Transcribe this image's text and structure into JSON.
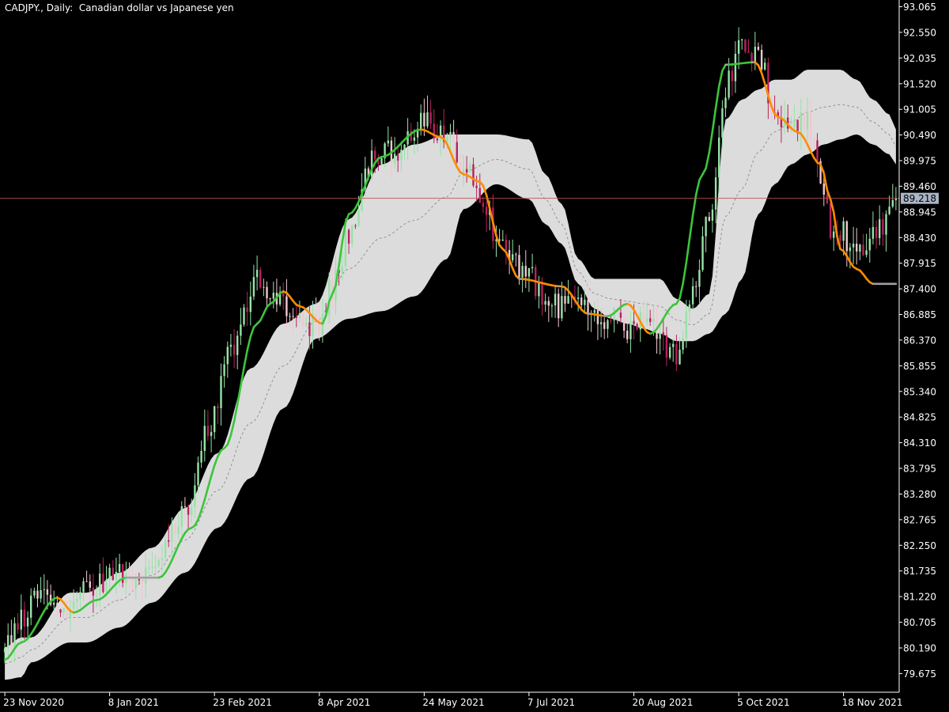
{
  "header": {
    "symbol": "CADJPY.",
    "timeframe": "Daily",
    "description": "Canadian dollar vs Japanese yen"
  },
  "colors": {
    "background": "#000000",
    "axis": "#ffffff",
    "band_fill": "#dcdcdc",
    "mid_line": "#808080",
    "bull_candle": "#98e3a8",
    "bear_candle": "#b8215f",
    "bear_candle_light": "#f2c6d2",
    "line_up": "#3cc43c",
    "line_down": "#ff8c00",
    "line_flat": "#a0a0a0",
    "current_price_line": "#c05050",
    "current_price_box": "#a9b5c4"
  },
  "current_price": {
    "label": "89.218",
    "value": 89.218
  },
  "chart_data": {
    "type": "candlestick",
    "title": "CADJPY., Daily:  Canadian dollar vs Japanese yen",
    "ylim": [
      79.3,
      93.2
    ],
    "y_ticks": [
      "93.065",
      "92.550",
      "92.035",
      "91.520",
      "91.005",
      "90.490",
      "89.975",
      "89.460",
      "88.945",
      "88.430",
      "87.915",
      "87.400",
      "86.885",
      "86.370",
      "85.855",
      "85.340",
      "84.825",
      "84.310",
      "83.795",
      "83.280",
      "82.765",
      "82.250",
      "81.735",
      "81.220",
      "80.705",
      "80.190",
      "79.675"
    ],
    "x_ticks": [
      "23 Nov 2020",
      "8 Jan 2021",
      "23 Feb 2021",
      "8 Apr 2021",
      "24 May 2021",
      "7 Jul 2021",
      "20 Aug 2021",
      "5 Oct 2021",
      "18 Nov 2021"
    ],
    "x_tick_index": [
      0,
      32,
      64,
      96,
      128,
      160,
      192,
      224,
      256
    ],
    "bars": 273,
    "moving_average": {
      "knots_index": [
        0,
        5,
        16,
        21,
        28,
        37,
        47,
        57,
        67,
        77,
        81,
        85,
        90,
        97,
        100,
        105,
        115,
        127,
        133,
        140,
        145,
        152,
        157,
        170,
        178,
        184,
        190,
        197,
        205,
        213,
        220,
        229,
        236,
        242,
        249,
        252,
        255,
        260,
        265,
        272
      ],
      "values": [
        79.95,
        80.3,
        81.2,
        80.9,
        81.15,
        81.6,
        81.6,
        82.6,
        84.2,
        86.7,
        87.1,
        87.35,
        87.05,
        86.7,
        87.3,
        88.9,
        90.05,
        90.6,
        90.45,
        89.7,
        89.55,
        88.2,
        87.6,
        87.45,
        86.9,
        86.85,
        87.1,
        86.5,
        87.1,
        89.7,
        91.9,
        91.95,
        90.85,
        90.55,
        89.9,
        89.2,
        88.2,
        87.8,
        87.5,
        87.5
      ]
    },
    "bands": {
      "knots_index": [
        0,
        5,
        8,
        20,
        25,
        35,
        45,
        55,
        65,
        75,
        85,
        95,
        105,
        115,
        125,
        135,
        140,
        150,
        160,
        165,
        170,
        175,
        180,
        185,
        190,
        195,
        200,
        205,
        210,
        215,
        220,
        225,
        230,
        235,
        240,
        245,
        250,
        255,
        260,
        265,
        270,
        272
      ],
      "upper": [
        80.2,
        80.4,
        80.4,
        81.3,
        81.3,
        81.7,
        82.2,
        83.0,
        84.1,
        85.8,
        86.7,
        87.1,
        88.8,
        89.9,
        90.3,
        90.5,
        90.5,
        90.5,
        90.4,
        89.7,
        89.1,
        88.0,
        87.6,
        87.6,
        87.6,
        87.6,
        87.6,
        87.2,
        87.0,
        87.3,
        90.8,
        91.2,
        91.4,
        91.6,
        91.6,
        91.8,
        91.8,
        91.8,
        91.6,
        91.2,
        90.9,
        90.6
      ],
      "lower": [
        79.55,
        79.6,
        79.9,
        80.3,
        80.3,
        80.6,
        81.1,
        81.7,
        82.6,
        83.6,
        85.0,
        86.4,
        86.8,
        86.95,
        87.25,
        88.0,
        89.0,
        89.5,
        89.2,
        88.7,
        88.3,
        87.5,
        87.0,
        86.8,
        86.7,
        86.6,
        86.5,
        86.35,
        86.35,
        86.5,
        86.9,
        87.6,
        88.9,
        89.5,
        89.9,
        90.1,
        90.3,
        90.4,
        90.5,
        90.3,
        90.1,
        89.9
      ]
    },
    "price_path": {
      "knots_index": [
        0,
        5,
        12,
        18,
        25,
        32,
        40,
        48,
        55,
        62,
        70,
        77,
        83,
        90,
        95,
        100,
        105,
        112,
        120,
        128,
        135,
        140,
        145,
        150,
        158,
        165,
        172,
        180,
        185,
        190,
        195,
        200,
        205,
        210,
        215,
        220,
        225,
        230,
        235,
        240,
        245,
        250,
        252,
        255,
        260,
        265,
        270,
        272
      ],
      "values": [
        80.1,
        80.8,
        81.4,
        80.9,
        81.3,
        81.6,
        81.6,
        82.2,
        82.9,
        84.5,
        86.3,
        87.6,
        87.3,
        86.8,
        86.6,
        87.4,
        88.5,
        90.0,
        90.2,
        90.7,
        90.5,
        89.8,
        89.4,
        88.5,
        87.8,
        87.2,
        87.0,
        86.9,
        86.8,
        86.6,
        86.8,
        86.4,
        86.1,
        87.4,
        89.0,
        91.5,
        92.4,
        92.1,
        91.0,
        90.7,
        90.7,
        89.5,
        88.6,
        88.6,
        88.1,
        88.4,
        88.8,
        89.218
      ]
    }
  }
}
